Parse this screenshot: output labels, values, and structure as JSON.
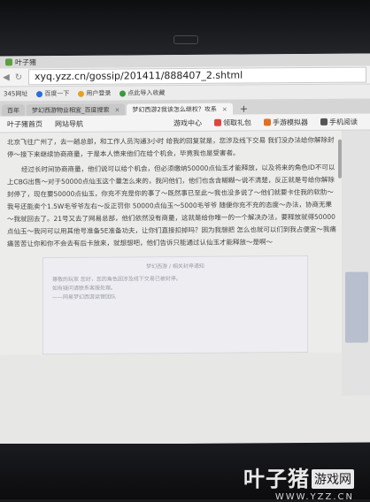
{
  "browser": {
    "title": "叶子猪",
    "url": "xyq.yzz.cn/gossip/201411/888407_2.shtml",
    "bookmarks": [
      "345网址",
      "百度一下",
      "用户登录",
      "点此导入收藏"
    ],
    "tabs": [
      {
        "label": "百年",
        "active": false
      },
      {
        "label": "梦幻西游物业相宜_百度搜索",
        "active": false
      },
      {
        "label": "梦幻西游2我该怎么继权？攻系",
        "active": true
      }
    ],
    "new_tab": "+"
  },
  "site_bar": {
    "logo": "叶子猪首页",
    "nav": "网站导航",
    "links": [
      "游戏中心",
      "领取礼包",
      "手游模拟器",
      "手机阅读"
    ]
  },
  "article": {
    "paragraphs": [
      "北京飞往广州了，去一趟总部，和工作人员沟通3小时 给我的回复就是，您涉及线下交易 我们没办法给你解除封停～接下来继续协商商量，于是本人愤来他们在给个机会，毕竟我也是受害者。",
      "经过长时间协商商量，他们说可以给个机会，但必须缴纳50000点仙玉才能释放，以及将来的角色ID不可以上CBG出售～对于50000点仙玉这个量怎么来的，我问他们，他们也含含糊糊～说不清楚，反正就是号给你解除封停了，现在要50000点仙玉，你充不充是你的事了～既然事已至此～我也没多说了～他们就要卡住我的软肋～我号还能卖个1.5W毛爷爷左右～反正罚你 50000点仙玉～5000毛爷爷 随便你充不充的态度～办法，协商无果～我就回去了。21号又去了网易总部，他们依然没有商量，这就是给你唯一的一个解决办法，要释放就得50000点仙玉～我问可以用其他号准备5E准备功夫，让你们直接扣掉吗？因为我想把 怎么也就可以们到我占便宜～我痛痛苦苦让你和你不会去有后卡放来，就想想吧，他们告诉只能通过认仙玉才能释放～是啊～"
    ],
    "embed_title": "梦幻西游 / 相关封停通知",
    "embed_lines": [
      "尊敬的玩家 您好，您的角色因涉及线下交易已被封停。",
      "如有疑问请联系客服处理。",
      "——网易梦幻西游运营团队"
    ]
  },
  "watermark": {
    "name": "叶子猪",
    "badge": "游戏网",
    "url": "WWW.YZZ.CN"
  }
}
